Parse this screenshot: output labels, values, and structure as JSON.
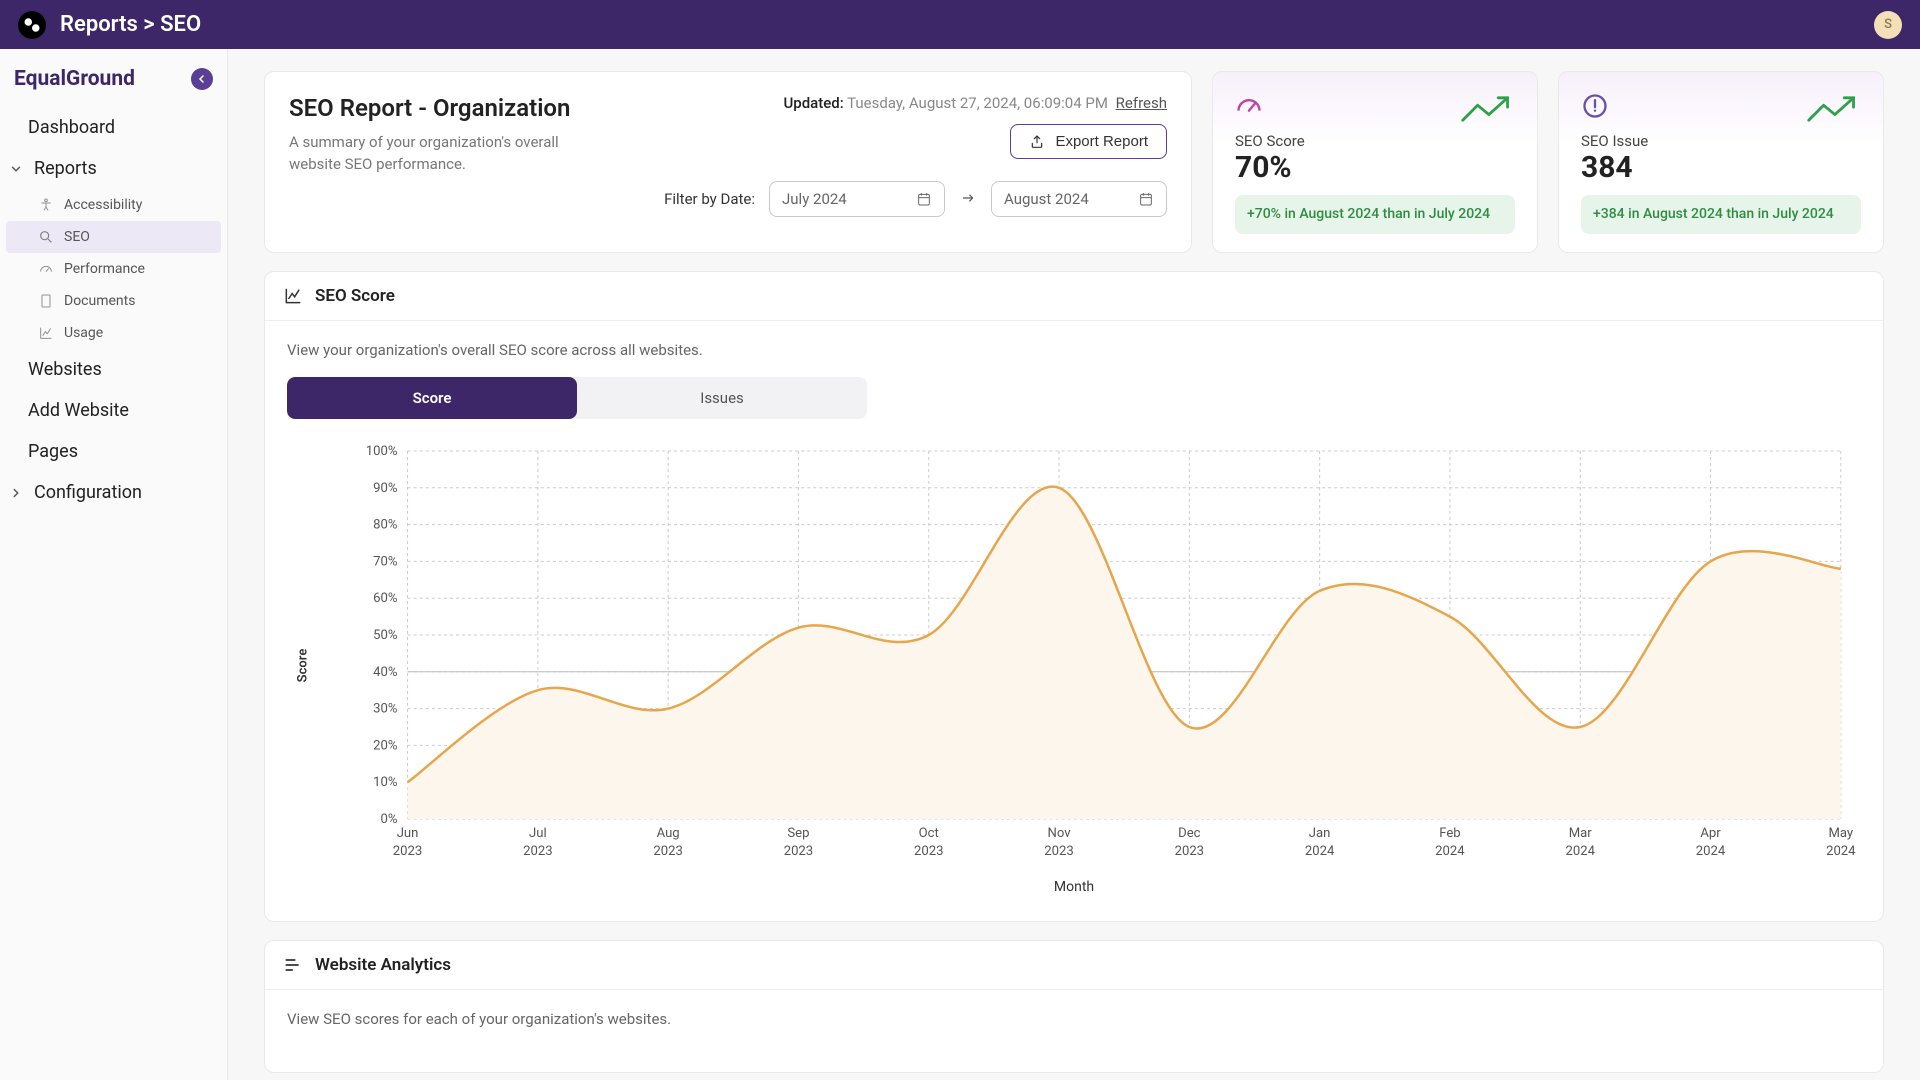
{
  "topbar": {
    "breadcrumb": "Reports > SEO",
    "avatar_initial": "S"
  },
  "sidebar": {
    "brand": "EqualGround",
    "items": {
      "dashboard": "Dashboard",
      "reports": "Reports",
      "websites": "Websites",
      "add_website": "Add Website",
      "pages": "Pages",
      "configuration": "Configuration"
    },
    "report_subs": {
      "accessibility": "Accessibility",
      "seo": "SEO",
      "performance": "Performance",
      "documents": "Documents",
      "usage": "Usage"
    }
  },
  "header": {
    "title": "SEO Report - Organization",
    "desc": "A summary of your organization's overall website SEO performance.",
    "updated_label": "Updated:",
    "updated_value": "Tuesday, August 27, 2024, 06:09:04 PM",
    "refresh": "Refresh",
    "export": "Export Report",
    "filter_label": "Filter by Date:",
    "date_from": "July 2024",
    "date_to": "August 2024"
  },
  "stats": {
    "score": {
      "label": "SEO Score",
      "value": "70%",
      "delta": "+70% in August 2024 than in July 2024"
    },
    "issue": {
      "label": "SEO Issue",
      "value": "384",
      "delta": "+384 in August 2024 than in July 2024"
    }
  },
  "score_section": {
    "title": "SEO Score",
    "desc": "View your organization's overall SEO score across all websites.",
    "tab_score": "Score",
    "tab_issues": "Issues",
    "ylabel": "Score",
    "xlabel": "Month"
  },
  "analytics_section": {
    "title": "Website Analytics",
    "desc": "View SEO scores for each of your organization's websites."
  },
  "chart_data": {
    "type": "line",
    "title": "SEO Score",
    "xlabel": "Month",
    "ylabel": "Score",
    "ylim": [
      0,
      100
    ],
    "categories": [
      "Jun 2023",
      "Jul 2023",
      "Aug 2023",
      "Sep 2023",
      "Oct 2023",
      "Nov 2023",
      "Dec 2023",
      "Jan 2024",
      "Feb 2024",
      "Mar 2024",
      "Apr 2024",
      "May 2024"
    ],
    "values": [
      10,
      35,
      30,
      52,
      50,
      90,
      25,
      62,
      55,
      25,
      70,
      68
    ]
  }
}
